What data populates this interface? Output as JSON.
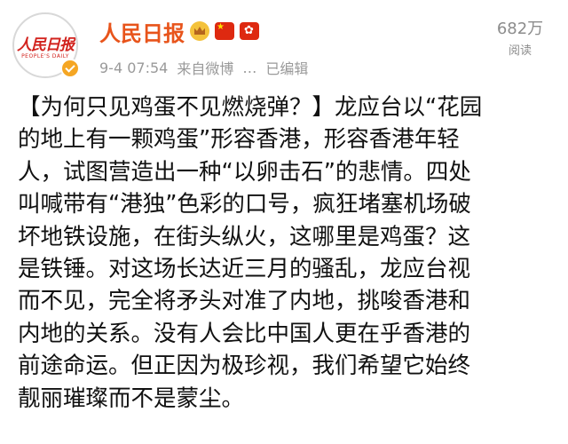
{
  "header": {
    "avatar_logo_text": "人民日报",
    "avatar_sub_text": "PEOPLE'S DAILY",
    "account_name": "人民日报",
    "badges": [
      "crown-icon",
      "flag-cn-icon",
      "flag-hk-icon"
    ],
    "date": "9-4 07:54",
    "source": "来自微博",
    "separator": "…",
    "edited": "已编辑",
    "view_count": "682万",
    "view_label": "阅读"
  },
  "post": {
    "lines": [
      "【为何只见鸡蛋不见燃烧弹？】龙应台以“花园",
      "的地上有一颗鸡蛋”形容香港，形容香港年轻",
      "人，试图营造出一种“以卵击石”的悲情。四处",
      "叫喊带有“港独”色彩的口号，疯狂堵塞机场破",
      "坏地铁设施，在街头纵火，这哪里是鸡蛋？这",
      "是铁锤。对这场长达近三月的骚乱，龙应台视",
      "而不见，完全将矛头对准了内地，挑唆香港和",
      "内地的关系。没有人会比中国人更在乎香港的",
      "前途命运。但正因为极珍视，我们希望它始终",
      "靓丽璀璨而不是蒙尘。"
    ]
  },
  "colors": {
    "account_name": "#e8541b",
    "meta": "#9a9a9a",
    "verified": "#f5a623",
    "logo_red": "#d2231e"
  }
}
